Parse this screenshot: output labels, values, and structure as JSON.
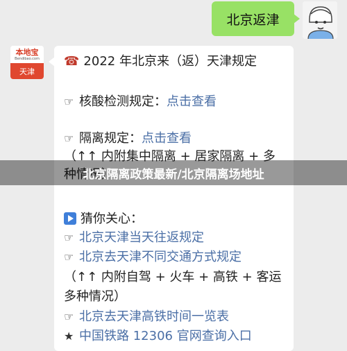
{
  "me": {
    "message": "北京返津"
  },
  "bot": {
    "logo": "本地宝",
    "url": "Bendibao.com",
    "city": "天津"
  },
  "content": {
    "title_icon": "telephone-icon",
    "title": "2022 年北京来（返）天津规定",
    "hand_icon": "☞",
    "line1_label": "核酸检测规定：",
    "line1_link": "点击查看",
    "line2_label": "隔离规定：",
    "line2_link": "点击查看",
    "line3": "（↑↑ 内附集中隔离 + 居家隔离 + 多",
    "line4": "种情况）",
    "guess_label": "猜你关心：",
    "link1": "北京天津当天往返规定",
    "link2": "北京去天津不同交通方式规定",
    "line5": "（↑↑ 内附自驾 + 火车 + 高铁 + 客运",
    "line6": "多种情况）",
    "link3": "北京去天津高铁时间一览表",
    "star": "★",
    "link4": "中国铁路 12306 官网查询入口"
  },
  "overlay": {
    "text": "北京隔离政策最新/北京隔离场地址"
  }
}
